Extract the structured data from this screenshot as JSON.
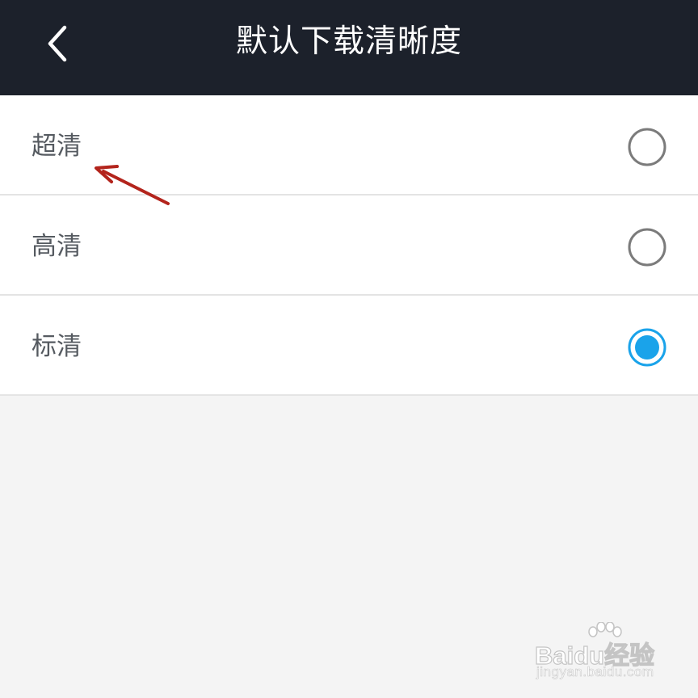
{
  "header": {
    "title": "默认下载清晰度",
    "back_icon": "chevron-left-icon",
    "background": "#1c212b"
  },
  "options": [
    {
      "label": "超清",
      "selected": false
    },
    {
      "label": "高清",
      "selected": false
    },
    {
      "label": "标清",
      "selected": true
    }
  ],
  "colors": {
    "selected_radio": "#1aa3ea",
    "unselected_radio": "#7b7b7b",
    "annotation_arrow": "#b3241c"
  },
  "watermark": {
    "logo": "Baidu经验",
    "url": "jingyan.baidu.com"
  }
}
